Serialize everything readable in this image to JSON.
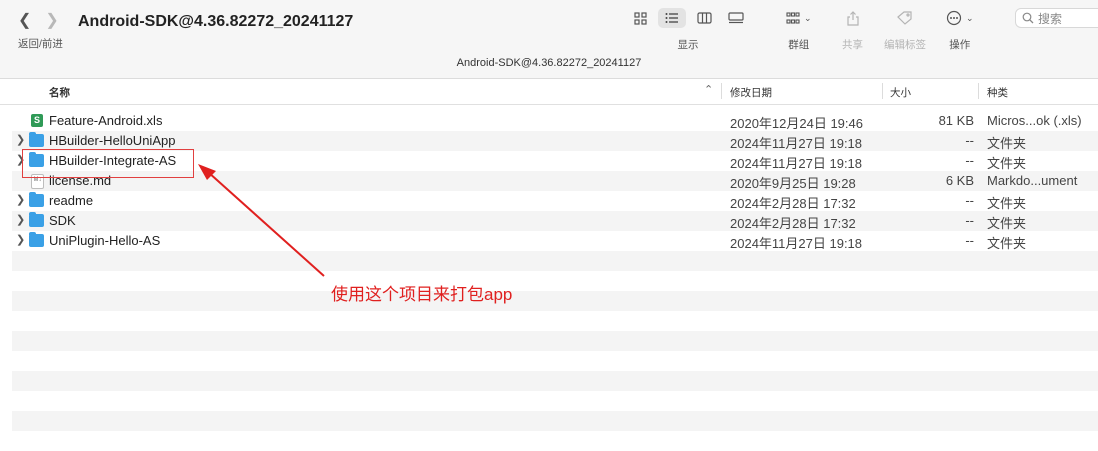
{
  "toolbar": {
    "nav_label": "返回/前进",
    "title": "Android-SDK@4.36.82272_20241127",
    "view_label": "显示",
    "group_label": "群组",
    "share_label": "共享",
    "tags_label": "编辑标签",
    "action_label": "操作",
    "search_placeholder": "搜索"
  },
  "path_bar": "Android-SDK@4.36.82272_20241127",
  "columns": {
    "name": "名称",
    "date": "修改日期",
    "size": "大小",
    "kind": "种类"
  },
  "files": [
    {
      "name": "Feature-Android.xls",
      "date": "2020年12月24日 19:46",
      "size": "81 KB",
      "kind": "Micros...ok (.xls)",
      "icon": "xls-file-icon",
      "expandable": false
    },
    {
      "name": "HBuilder-HelloUniApp",
      "date": "2024年11月27日 19:18",
      "size": "--",
      "kind": "文件夹",
      "icon": "folder-icon",
      "expandable": true
    },
    {
      "name": "HBuilder-Integrate-AS",
      "date": "2024年11月27日 19:18",
      "size": "--",
      "kind": "文件夹",
      "icon": "folder-icon",
      "expandable": true
    },
    {
      "name": "license.md",
      "date": "2020年9月25日 19:28",
      "size": "6 KB",
      "kind": "Markdo...ument",
      "icon": "markdown-file-icon",
      "expandable": false
    },
    {
      "name": "readme",
      "date": "2024年2月28日 17:32",
      "size": "--",
      "kind": "文件夹",
      "icon": "folder-icon",
      "expandable": true
    },
    {
      "name": "SDK",
      "date": "2024年2月28日 17:32",
      "size": "--",
      "kind": "文件夹",
      "icon": "folder-icon",
      "expandable": true
    },
    {
      "name": "UniPlugin-Hello-AS",
      "date": "2024年11月27日 19:18",
      "size": "--",
      "kind": "文件夹",
      "icon": "folder-icon",
      "expandable": true
    }
  ],
  "annotation": {
    "text": "使用这个项目来打包app",
    "color": "#e0201f"
  }
}
